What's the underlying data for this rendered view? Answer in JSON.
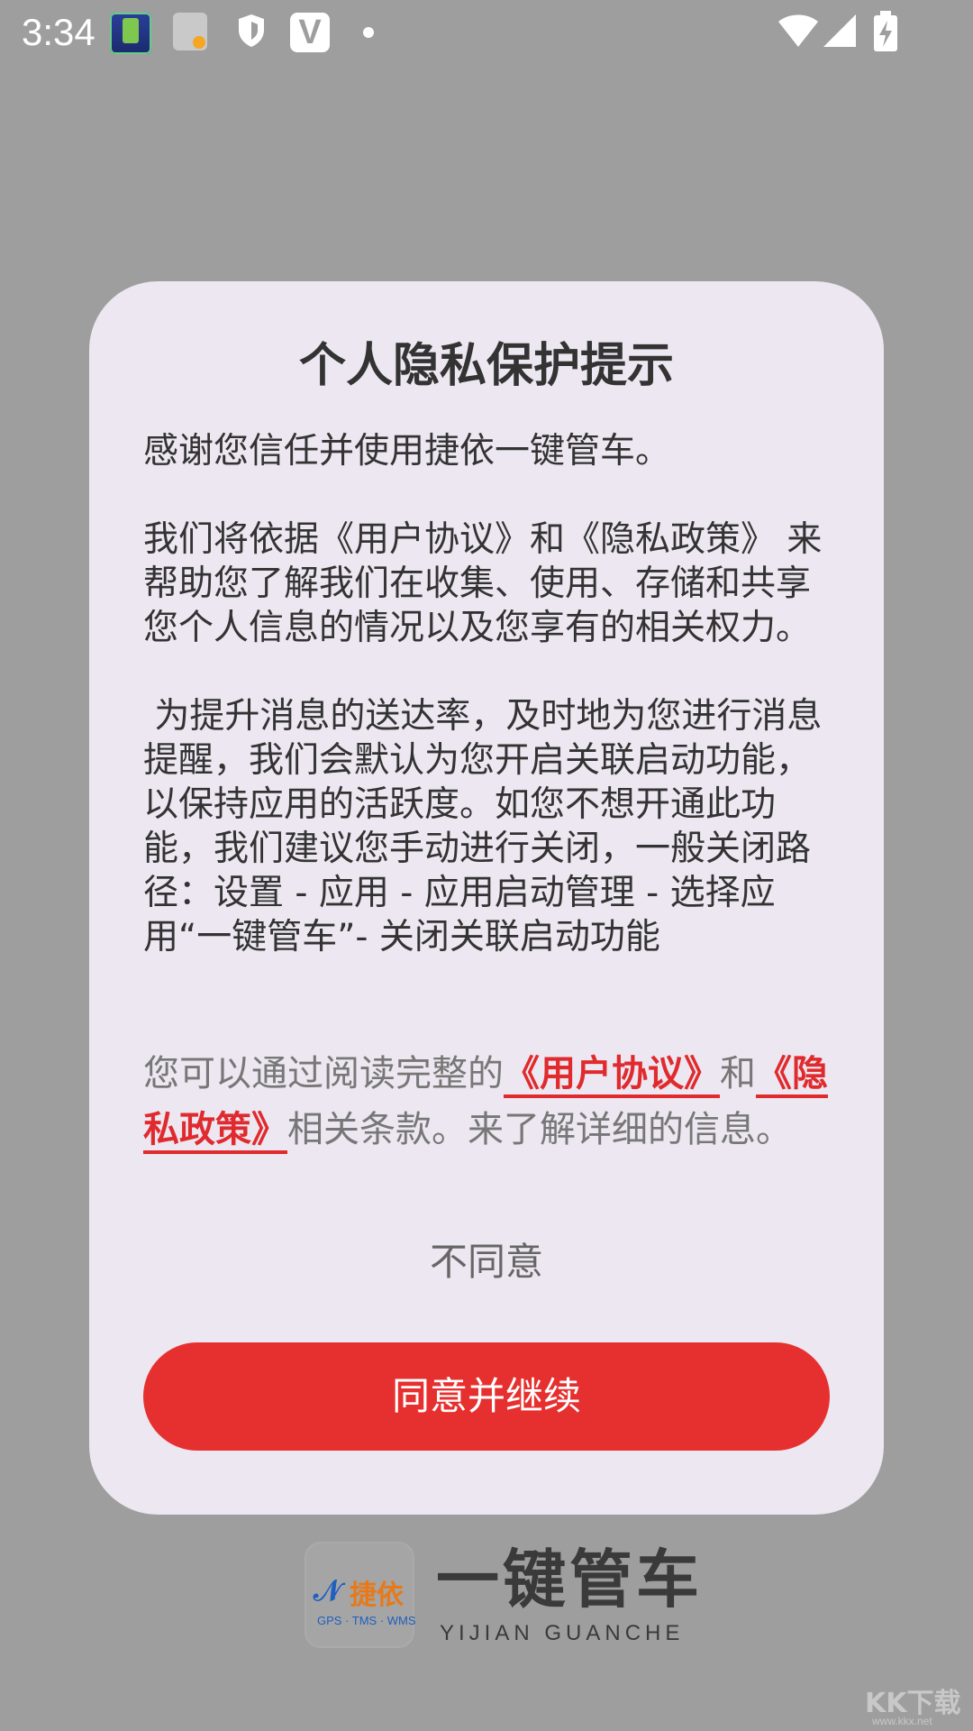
{
  "status_bar": {
    "time": "3:34",
    "icons": [
      "battery-app-icon",
      "clipboard-icon",
      "shield-icon",
      "v-app-icon",
      "notification-dot-icon",
      "wifi-icon",
      "signal-icon",
      "battery-charging-icon"
    ],
    "v_label": "V"
  },
  "dialog": {
    "title": "个人隐私保护提示",
    "paragraphs": [
      "感谢您信任并使用捷依一键管车。",
      "我们将依据《用户协议》和《隐私政策》 来帮助您了解我们在收集、使用、存储和共享您个人信息的情况以及您享有的相关权力。",
      " 为提升消息的送达率，及时地为您进行消息提醒，我们会默认为您开启关联启动功能，以保持应用的活跃度。如您不想开通此功能，我们建议您手动进行关闭，一般关闭路径：设置 - 应用 - 应用启动管理 - 选择应用“一键管车”- 关闭关联启动功能"
    ],
    "summary_prefix": "您可以通过阅读完整的",
    "user_agreement_link": "《用户协议》",
    "summary_and": "和",
    "privacy_policy_link": "《隐私政策》",
    "summary_suffix": "相关条款。来了解详细的信息。",
    "disagree_label": "不同意",
    "agree_label": "同意并继续"
  },
  "brand": {
    "logo_name": "捷依",
    "logo_sub": "GPS · TMS · WMS",
    "app_name": "一键管车",
    "pinyin": "YIJIAN GUANCHE"
  },
  "watermark": {
    "text": "KK下载",
    "sub": "www.kkx.net"
  },
  "colors": {
    "accent": "#e6302f",
    "link": "#e02a2e",
    "dialog_bg": "#ece7f0",
    "scrim": "#9e9e9e"
  }
}
